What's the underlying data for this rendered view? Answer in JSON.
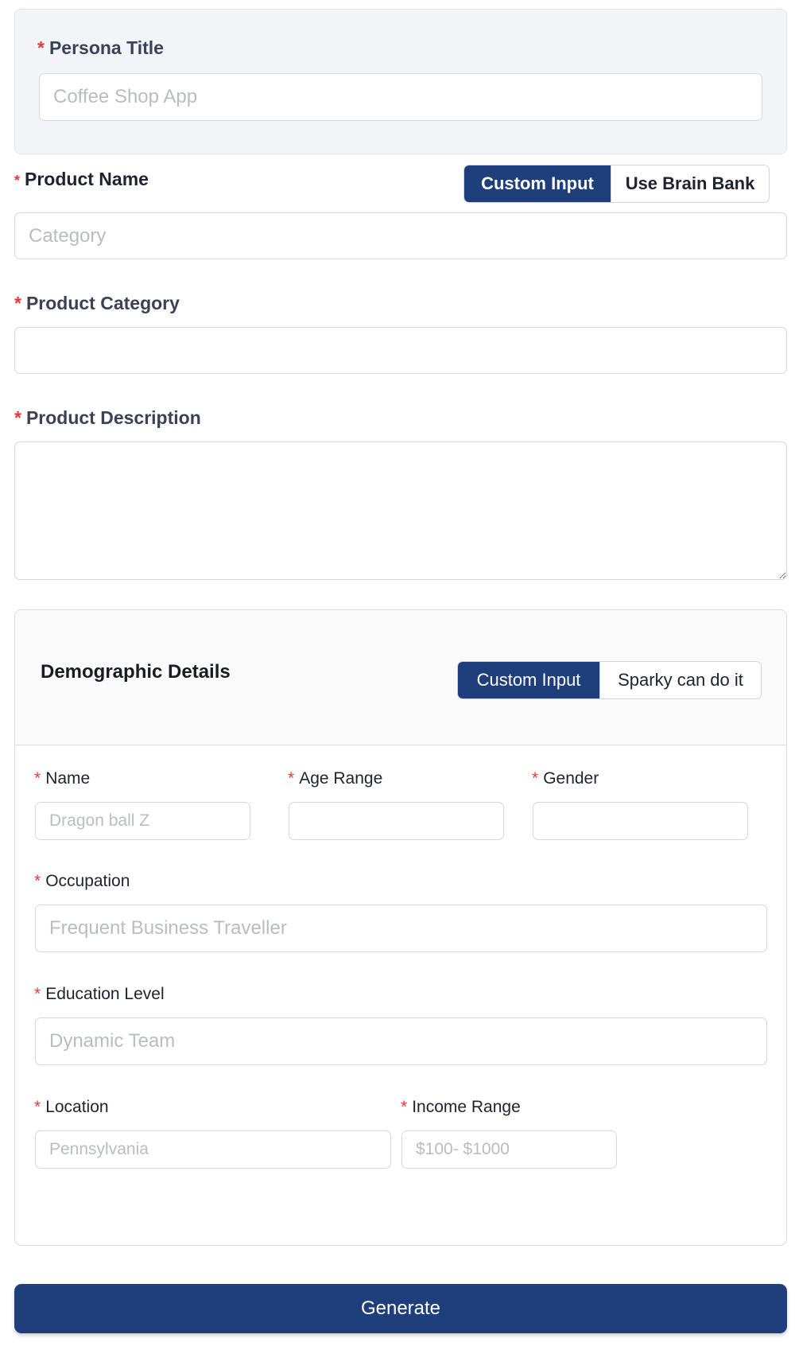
{
  "persona": {
    "title_label": "Persona Title",
    "title_placeholder": "Coffee Shop App"
  },
  "product": {
    "name_label": "Product Name",
    "name_placeholder": "Category",
    "source_toggle": {
      "custom_label": "Custom Input",
      "brain_bank_label": "Use Brain Bank",
      "selected": "Custom Input"
    },
    "category_label": "Product Category",
    "category_placeholder": "",
    "description_label": "Product Description",
    "description_placeholder": ""
  },
  "demographics": {
    "title": "Demographic Details",
    "source_toggle": {
      "custom_label": "Custom Input",
      "sparky_label": "Sparky can do it",
      "selected": "Custom Input"
    },
    "name_label": "Name",
    "name_placeholder": "Dragon ball Z",
    "age_label": "Age Range",
    "age_placeholder": "",
    "gender_label": "Gender",
    "gender_placeholder": "",
    "occupation_label": "Occupation",
    "occupation_placeholder": "Frequent Business Traveller",
    "education_label": "Education Level",
    "education_placeholder": "Dynamic Team",
    "location_label": "Location",
    "location_placeholder": "Pennsylvania",
    "income_label": "Income Range",
    "income_placeholder": "$100- $1000"
  },
  "required_marker": "*",
  "generate_label": "Generate",
  "colors": {
    "primary": "#1e3f7c",
    "required": "#e53935",
    "label": "#3b4256",
    "border": "#d4d7dd",
    "placeholder": "#b9bcc3"
  }
}
